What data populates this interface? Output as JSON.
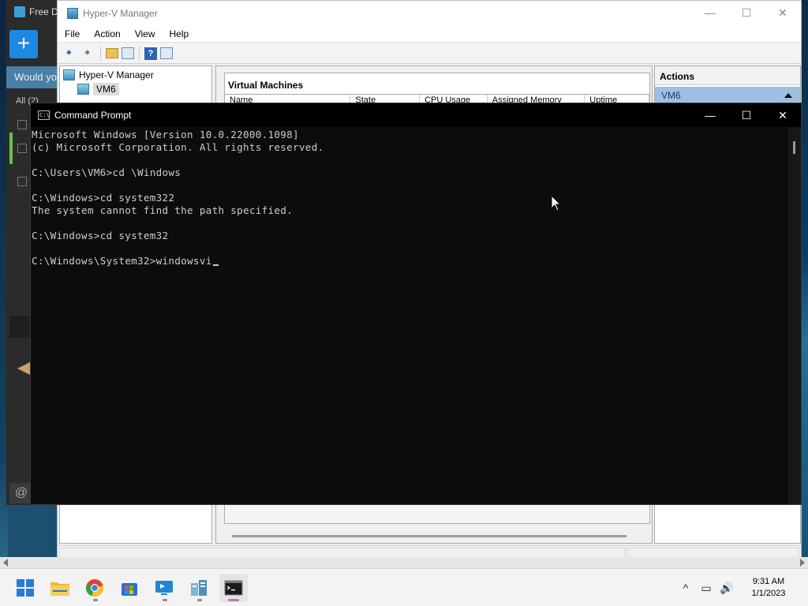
{
  "background_app": {
    "title": "Free D",
    "plus_label": "+",
    "banner_text": "Would yo",
    "tab_label": "All (2)"
  },
  "hyperv": {
    "title": "Hyper-V Manager",
    "controls": {
      "minimize": "—",
      "maximize": "☐",
      "close": "✕"
    },
    "menu": [
      "File",
      "Action",
      "View",
      "Help"
    ],
    "tree": {
      "root": "Hyper-V Manager",
      "child": "VM6"
    },
    "center": {
      "panel_title": "Virtual Machines",
      "columns": [
        "Name",
        "State",
        "CPU Usage",
        "Assigned Memory",
        "Uptime"
      ]
    },
    "actions": {
      "title": "Actions",
      "selected": "VM6"
    }
  },
  "cmd": {
    "title": "Command Prompt",
    "controls": {
      "minimize": "—",
      "maximize": "☐",
      "close": "✕"
    },
    "lines": [
      "Microsoft Windows [Version 10.0.22000.1098]",
      "(c) Microsoft Corporation. All rights reserved.",
      "",
      "C:\\Users\\VM6>cd \\Windows",
      "",
      "C:\\Windows>cd system322",
      "The system cannot find the path specified.",
      "",
      "C:\\Windows>cd system32",
      "",
      "C:\\Windows\\System32>windowsvi"
    ]
  },
  "taskbar": {
    "apps": [
      "start-icon",
      "file-explorer-icon",
      "chrome-icon",
      "store-icon",
      "remote-desktop-icon",
      "hyperv-manager-icon",
      "command-prompt-icon"
    ],
    "tray": {
      "chevron": "^",
      "network": "▭",
      "volume": "🔊"
    },
    "clock": {
      "time": "9:31 AM",
      "date": "1/1/2023"
    }
  },
  "colors": {
    "cmd_bg": "#0c0c0c",
    "cmd_text": "#cccccc",
    "accent": "#1e88e5",
    "selection": "#9fbfe0"
  }
}
